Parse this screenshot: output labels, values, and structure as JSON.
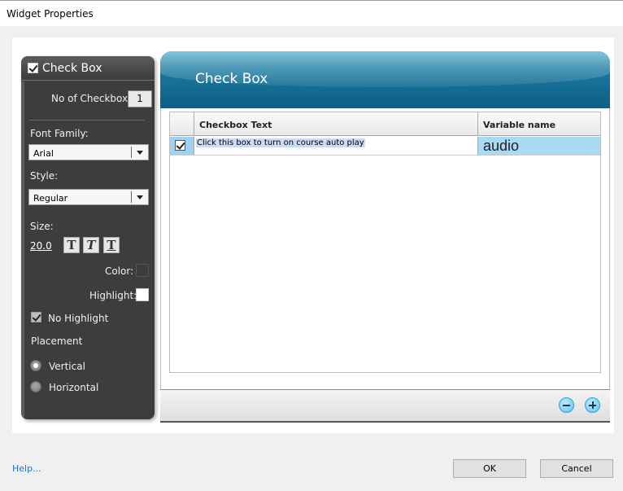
{
  "window": {
    "title": "Widget Properties"
  },
  "left_panel": {
    "header_title": "Check Box",
    "no_of_checkbox_label": "No of Checkbox:",
    "no_of_checkbox_value": "1",
    "font_family_label": "Font Family:",
    "font_family_value": "Arial",
    "style_label": "Style:",
    "style_value": "Regular",
    "size_label": "Size:",
    "size_value": "20.0",
    "bold_glyph": "T",
    "italic_glyph": "T",
    "underline_glyph": "T",
    "color_label": "Color:",
    "color_value": "#3d3d3d",
    "highlight_label": "Highlight:",
    "highlight_value": "#ffffff",
    "no_highlight_label": "No Highlight",
    "placement_label": "Placement",
    "vertical_label": "Vertical",
    "horizontal_label": "Horizontal"
  },
  "right_panel": {
    "header_title": "Check Box",
    "grid": {
      "headers": [
        "Checkbox Text",
        "Variable name"
      ],
      "rows": [
        {
          "checked": true,
          "text": "Click this box to turn on course auto play",
          "variable": "audio"
        }
      ]
    }
  },
  "footer": {
    "help_link": "Help...",
    "ok_label": "OK",
    "cancel_label": "Cancel"
  },
  "colors": {
    "accent": "#0e5e84",
    "panel_bg": "#3d3d3d",
    "selection": "#a8d9f5"
  }
}
